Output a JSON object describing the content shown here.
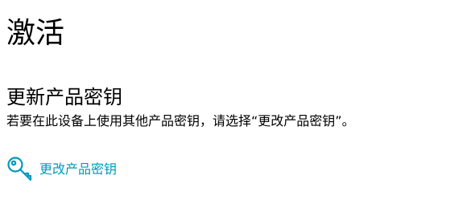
{
  "page": {
    "title": "激活"
  },
  "product_key_section": {
    "heading": "更新产品密钥",
    "description": "若要在此设备上使用其他产品密钥，请选择“更改产品密钥”。",
    "change_link": {
      "label": "更改产品密钥",
      "icon": "key-icon"
    }
  },
  "colors": {
    "accent": "#0099bc",
    "text": "#000000",
    "background": "#ffffff"
  }
}
